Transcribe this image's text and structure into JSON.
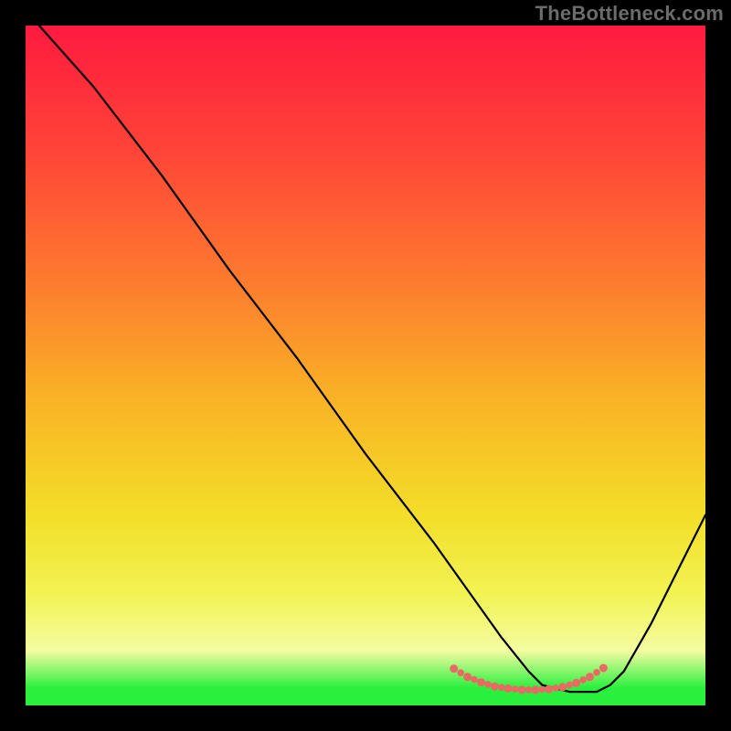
{
  "watermark": "TheBottleneck.com",
  "chart_data": {
    "type": "line",
    "title": "",
    "xlabel": "",
    "ylabel": "",
    "xlim": [
      0,
      100
    ],
    "ylim": [
      0,
      100
    ],
    "grid": false,
    "legend": false,
    "series": [
      {
        "name": "black-curve",
        "color": "#000000",
        "x": [
          2,
          10,
          20,
          30,
          40,
          50,
          60,
          65,
          70,
          74,
          76,
          80,
          84,
          86,
          88,
          92,
          96,
          100
        ],
        "y": [
          100,
          91,
          78,
          64,
          51,
          37,
          24,
          17,
          10,
          5,
          3,
          2,
          2,
          3,
          5,
          12,
          20,
          28
        ]
      },
      {
        "name": "green-band",
        "type": "band",
        "color": "#28f03c",
        "x0": 0,
        "x1": 100,
        "y0": 0,
        "y1": 2.5
      },
      {
        "name": "red-dash-valley",
        "type": "dotted-line",
        "color": "#e86a63",
        "x": [
          63,
          65,
          67,
          69,
          71,
          73,
          75,
          77,
          79,
          81,
          83,
          85
        ],
        "y": [
          5.4,
          4.2,
          3.4,
          2.8,
          2.5,
          2.3,
          2.3,
          2.4,
          2.7,
          3.3,
          4.2,
          5.5
        ]
      }
    ],
    "gradient_background": {
      "type": "linear-vertical",
      "stops": [
        {
          "offset": 0.0,
          "color": "#ff1a3f"
        },
        {
          "offset": 0.18,
          "color": "#ff4338"
        },
        {
          "offset": 0.38,
          "color": "#fd7c2e"
        },
        {
          "offset": 0.55,
          "color": "#f9b325"
        },
        {
          "offset": 0.72,
          "color": "#f3de28"
        },
        {
          "offset": 0.84,
          "color": "#f2f455"
        },
        {
          "offset": 0.92,
          "color": "#f4fca2"
        },
        {
          "offset": 0.975,
          "color": "#28f03c"
        },
        {
          "offset": 1.0,
          "color": "#28f03c"
        }
      ]
    }
  }
}
